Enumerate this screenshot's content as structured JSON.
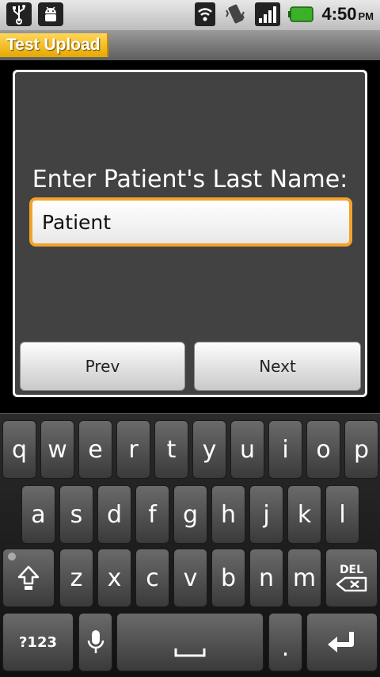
{
  "status_bar": {
    "time": "4:50",
    "ampm": "PM",
    "icons": [
      "usb-icon",
      "android-debug-icon",
      "wifi-icon",
      "vibrate-icon",
      "signal-icon",
      "battery-icon"
    ]
  },
  "app": {
    "title": "Test Upload"
  },
  "dialog": {
    "prompt": "Enter Patient's Last Name:",
    "input_value": "Patient",
    "prev_label": "Prev",
    "next_label": "Next"
  },
  "keyboard": {
    "row1": [
      "q",
      "w",
      "e",
      "r",
      "t",
      "y",
      "u",
      "i",
      "o",
      "p"
    ],
    "row2": [
      "a",
      "s",
      "d",
      "f",
      "g",
      "h",
      "j",
      "k",
      "l"
    ],
    "row3": [
      "z",
      "x",
      "c",
      "v",
      "b",
      "n",
      "m"
    ],
    "symbols_label": "?123",
    "del_label": "DEL",
    "period_label": "."
  },
  "colors": {
    "accent": "#f2a32b",
    "title_chip": "#f5c22c",
    "dialog_bg": "#424242"
  }
}
